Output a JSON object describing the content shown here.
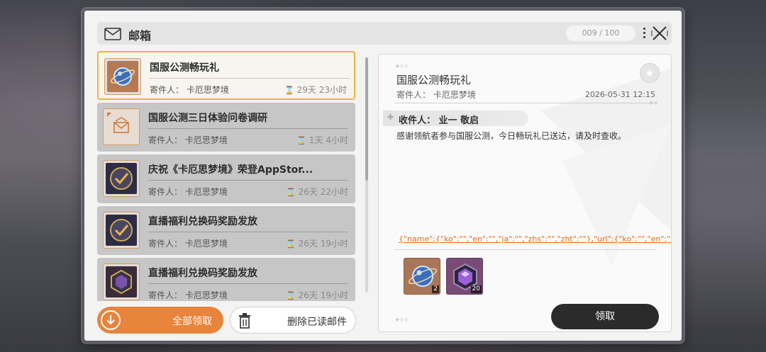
{
  "header": {
    "title": "邮箱",
    "counter": "009 / 100"
  },
  "mail_list": [
    {
      "title": "国服公测畅玩礼",
      "sender": "寄件人： 卡厄思梦境",
      "time": "29天 23小时",
      "icon": "globe-crystal-icon",
      "active": true
    },
    {
      "title": "国服公测三日体验问卷调研",
      "sender": "寄件人： 卡厄思梦境",
      "time": "1天 4小时",
      "icon": "envelope-icon",
      "active": false
    },
    {
      "title": "庆祝《卡厄思梦境》荣登AppStor...",
      "sender": "寄件人： 卡厄思梦境",
      "time": "26天 22小时",
      "icon": "check-badge-icon",
      "active": false
    },
    {
      "title": "直播福利兑换码奖励发放",
      "sender": "寄件人： 卡厄思梦境",
      "time": "26天 19小时",
      "icon": "check-badge-icon",
      "active": false
    },
    {
      "title": "直播福利兑换码奖励发放",
      "sender": "寄件人： 卡厄思梦境",
      "time": "26天 19小时",
      "icon": "gem-case-icon",
      "active": false
    }
  ],
  "buttons": {
    "claim_all": "全部领取",
    "delete_read": "删除已读邮件",
    "claim": "领取"
  },
  "detail": {
    "title": "国服公测畅玩礼",
    "sender": "寄件人： 卡厄思梦境",
    "date": "2026-05-31 12:15",
    "recipient": "收件人： 业一 敬启",
    "body": "感谢领航者参与国服公测，今日畅玩礼已送达，请及时查收。",
    "json_line": "{\"name\":{\"ko\":\"\",\"en\":\"\",\"ja\":\"\",\"zhs\":\"\",\"zht\":\"\"},\"url\":{\"ko\":\"\",\"en\":\"\",\"ja\":\"\",\"zhs\":\"\",",
    "rewards": [
      {
        "icon": "globe-crystal-icon",
        "qty": "2"
      },
      {
        "icon": "purple-gem-icon",
        "qty": "20"
      }
    ]
  },
  "colors": {
    "accent": "#e8843b",
    "active_border": "#f0b23a",
    "claim_button": "#2b2b2b",
    "json_text": "#e56b1f"
  }
}
